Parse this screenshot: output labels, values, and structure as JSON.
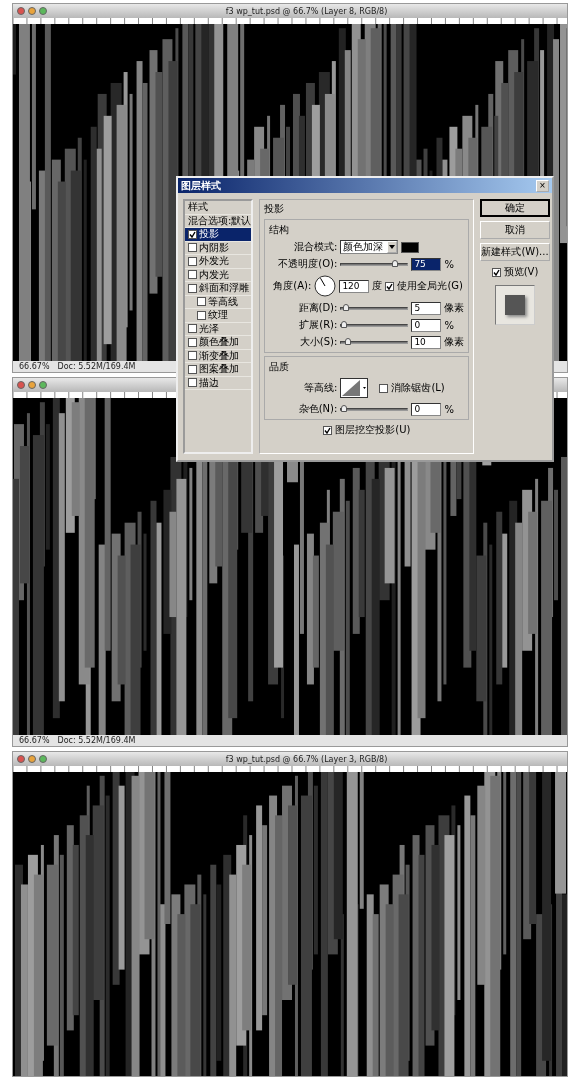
{
  "windows": [
    {
      "title": "f3 wp_tut.psd @ 66.7% (Layer 8, RGB/8)",
      "status": {
        "zoom": "66.67%",
        "doc": "Doc: 5.52M/169.4M"
      }
    },
    {
      "status": {
        "zoom": "66.67%",
        "doc": "Doc: 5.52M/169.4M"
      }
    },
    {
      "title": "f3 wp_tut.psd @ 66.7% (Layer 3, RGB/8)"
    }
  ],
  "dialog": {
    "title": "图层样式",
    "close": "×",
    "styles": [
      {
        "kind": "header",
        "label": "样式",
        "selected": false
      },
      {
        "kind": "option",
        "label": "混合选项:默认",
        "selected": false
      },
      {
        "kind": "effect",
        "label": "投影",
        "checked": true,
        "selected": true
      },
      {
        "kind": "effect",
        "label": "内阴影",
        "checked": false,
        "selected": false
      },
      {
        "kind": "effect",
        "label": "外发光",
        "checked": false,
        "selected": false
      },
      {
        "kind": "effect",
        "label": "内发光",
        "checked": false,
        "selected": false
      },
      {
        "kind": "effect",
        "label": "斜面和浮雕",
        "checked": false,
        "selected": false,
        "children": [
          {
            "kind": "effect",
            "label": "等高线",
            "checked": false,
            "selected": false
          },
          {
            "kind": "effect",
            "label": "纹理",
            "checked": false,
            "selected": false
          }
        ]
      },
      {
        "kind": "effect",
        "label": "光泽",
        "checked": false,
        "selected": false
      },
      {
        "kind": "effect",
        "label": "颜色叠加",
        "checked": false,
        "selected": false
      },
      {
        "kind": "effect",
        "label": "渐变叠加",
        "checked": false,
        "selected": false
      },
      {
        "kind": "effect",
        "label": "图案叠加",
        "checked": false,
        "selected": false
      },
      {
        "kind": "effect",
        "label": "描边",
        "checked": false,
        "selected": false
      }
    ],
    "section_title": "投影",
    "structure": {
      "title": "结构",
      "blend_mode": {
        "label": "混合模式:",
        "value": "颜色加深"
      },
      "opacity": {
        "label": "不透明度(O):",
        "level": 0.85,
        "value": "75",
        "unit": "%"
      },
      "angle": {
        "label": "角度(A):",
        "value": "120",
        "unit": "度",
        "global_light": {
          "label": "使用全局光(G)",
          "checked": true
        }
      },
      "sliders": [
        {
          "label": "距离(D):",
          "level": 0.03,
          "value": "5",
          "unit": "像素"
        },
        {
          "label": "扩展(R):",
          "level": 0,
          "value": "0",
          "unit": "%"
        },
        {
          "label": "大小(S):",
          "level": 0.06,
          "value": "10",
          "unit": "像素"
        }
      ]
    },
    "quality": {
      "title": "品质",
      "contour_label": "等高线:",
      "anti_alias": {
        "label": "消除锯齿(L)",
        "checked": false
      },
      "noise": {
        "label": "杂色(N):",
        "level": 0,
        "value": "0",
        "unit": "%"
      }
    },
    "knockout": {
      "label": "图层挖空投影(U)",
      "checked": true
    },
    "buttons": [
      {
        "label": "确定",
        "default": true
      },
      {
        "label": "取消",
        "default": false
      },
      {
        "label": "新建样式(W)...",
        "default": false
      }
    ],
    "preview": {
      "label": "预览(V)",
      "checked": true
    }
  }
}
